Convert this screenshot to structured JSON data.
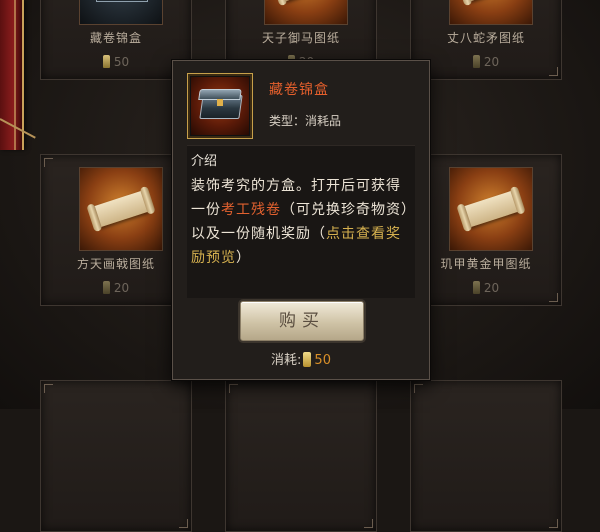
{
  "shop_items": [
    {
      "name": "藏卷锦盒",
      "cost": "50"
    },
    {
      "name": "天子御马图纸",
      "cost": "20"
    },
    {
      "name": "丈八蛇矛图纸",
      "cost": "20"
    },
    {
      "name": "方天画戟图纸",
      "cost": "20"
    },
    {
      "name": "玑甲黄金甲图纸",
      "cost": "20"
    }
  ],
  "popup": {
    "item_name": "藏卷锦盒",
    "item_type": "类型：消耗品",
    "desc_heading": "介绍",
    "desc_part1": "装饰考究的方盒。打开后可获得一份",
    "desc_highlight": "考工残卷",
    "desc_part2": "（可兑换珍奇物资）以及一份随机奖励（",
    "desc_link": "点击查看奖励预览",
    "desc_part3": "）",
    "buy_label": "购买",
    "cost_label": "消耗:",
    "cost_value": "50"
  },
  "colors": {
    "item_name": "#e45f2c",
    "highlight": "#e2612f",
    "link": "#d6b14f",
    "cost_value": "#d98f28"
  },
  "icons": [
    "chest-icon",
    "scroll-icon",
    "token-icon"
  ]
}
